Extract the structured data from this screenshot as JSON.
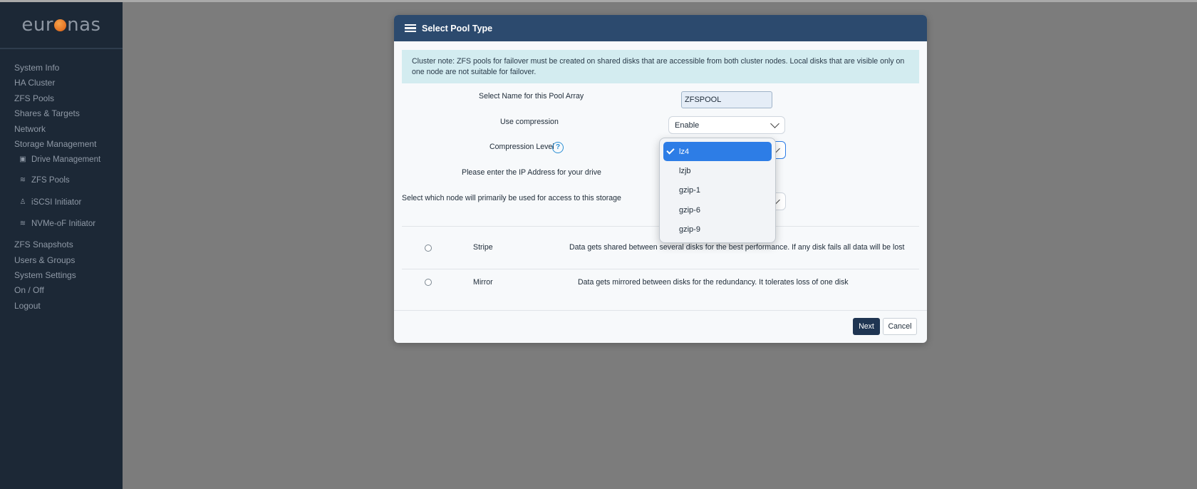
{
  "brand": {
    "logo_prefix": "eur",
    "logo_suffix": "nas"
  },
  "sidebar": {
    "items": [
      {
        "label": "System Info"
      },
      {
        "label": "HA Cluster"
      },
      {
        "label": "ZFS Pools"
      },
      {
        "label": "Shares & Targets"
      },
      {
        "label": "Network"
      },
      {
        "label": "Storage Management"
      }
    ],
    "subitems": [
      {
        "label": "Drive Management",
        "icon": "drive-icon"
      },
      {
        "label": "ZFS Pools",
        "icon": "layers-icon"
      },
      {
        "label": "iSCSI Initiator",
        "icon": "user-node-icon"
      },
      {
        "label": "NVMe-oF Initiator",
        "icon": "layers-icon"
      }
    ],
    "items_after": [
      {
        "label": "ZFS Snapshots"
      },
      {
        "label": "Users & Groups"
      },
      {
        "label": "System Settings"
      },
      {
        "label": "On / Off"
      },
      {
        "label": "Logout"
      }
    ]
  },
  "dialog": {
    "title": "Select Pool Type",
    "note": "Cluster note: ZFS pools for failover must be created on shared disks that are accessible from both cluster nodes. Local disks that are visible only on one node are not suitable for failover.",
    "name_label": "Select Name for this Pool Array",
    "name_value": "ZFSPOOL",
    "compression_label": "Use compression",
    "compression_value": "Enable",
    "compression_level_label": "Compression Level",
    "ip_label": "Please enter the IP Address for your drive",
    "node_label": "Select which node will primarily be used for access to this storage",
    "pool_types": [
      {
        "name": "Stripe",
        "description": "Data gets shared between several disks for the best performance. If any disk fails all data will be lost"
      },
      {
        "name": "Mirror",
        "description": "Data gets mirrored between disks for the redundancy. It tolerates loss of one disk"
      }
    ],
    "next_label": "Next",
    "cancel_label": "Cancel"
  },
  "compression_dropdown": {
    "selected": "lz4",
    "options": [
      "lz4",
      "lzjb",
      "gzip-1",
      "gzip-6",
      "gzip-9"
    ]
  },
  "colors": {
    "sidebar_bg": "#1c2836",
    "dialog_header": "#2c4a6e",
    "note_bg": "#d3ecf0",
    "next_button": "#1f3552",
    "selected_option": "#2d7de6"
  }
}
